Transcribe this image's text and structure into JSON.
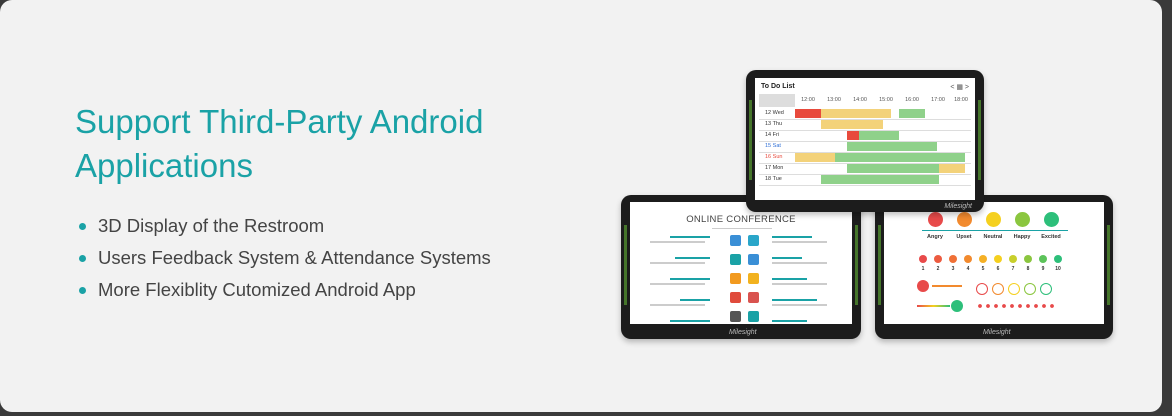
{
  "heading": {
    "line1": "Support Third-Party Android",
    "line2": "Applications"
  },
  "features": [
    "3D Display of the Restroom",
    "Users Feedback System & Attendance Systems",
    "More Flexiblity Cutomized Android App"
  ],
  "colors": {
    "accent": "#1aa2a6",
    "bezel": "#1c1c1c"
  },
  "todo_screen": {
    "title": "To Do List",
    "nav": "< ▦ >",
    "times": [
      "12:00",
      "13:00",
      "14:00",
      "15:00",
      "16:00",
      "17:00",
      "18:00"
    ],
    "days": [
      {
        "date": "12",
        "day": "Wed"
      },
      {
        "date": "13",
        "day": "Thu"
      },
      {
        "date": "14",
        "day": "Fri"
      },
      {
        "date": "15",
        "day": "Sat"
      },
      {
        "date": "16",
        "day": "Sun"
      },
      {
        "date": "17",
        "day": "Mon"
      },
      {
        "date": "18",
        "day": "Tue"
      }
    ],
    "brand": "Milesight"
  },
  "conference_screen": {
    "title": "ONLINE CONFERENCE",
    "brand": "Milesight"
  },
  "feedback_screen": {
    "moods": [
      "Angry",
      "Upset",
      "Neutral",
      "Happy",
      "Excited"
    ],
    "scale": [
      "1",
      "2",
      "3",
      "4",
      "5",
      "6",
      "7",
      "8",
      "9",
      "10"
    ],
    "brand": "Milesight"
  }
}
